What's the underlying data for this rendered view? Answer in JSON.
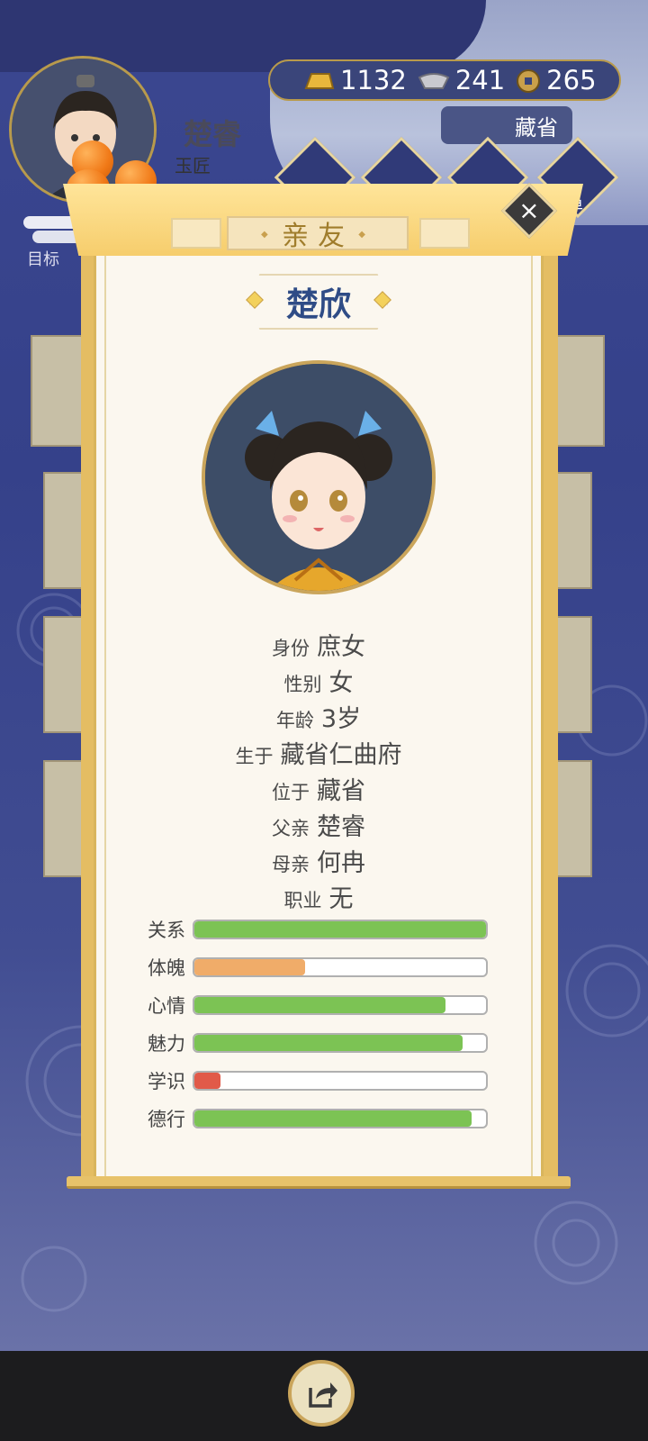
{
  "player": {
    "name": "楚睿",
    "job": "玉匠",
    "goal_label": "目标"
  },
  "currencies": [
    {
      "icon": "gold-ingot-icon",
      "value": "1132"
    },
    {
      "icon": "silver-ingot-icon",
      "value": "241"
    },
    {
      "icon": "copper-coin-icon",
      "value": "265"
    }
  ],
  "region_button": "藏省",
  "menu_partial_label": "单",
  "modal": {
    "title": "亲友",
    "close_icon": "close-icon",
    "person_name": "楚欣",
    "info": [
      {
        "label": "身份",
        "value": "庶女"
      },
      {
        "label": "性别",
        "value": "女"
      },
      {
        "label": "年龄",
        "value": "3岁"
      },
      {
        "label": "生于",
        "value": "藏省仁曲府"
      },
      {
        "label": "位于",
        "value": "藏省"
      },
      {
        "label": "父亲",
        "value": "楚睿"
      },
      {
        "label": "母亲",
        "value": "何冉"
      },
      {
        "label": "职业",
        "value": "无"
      }
    ],
    "stats": [
      {
        "label": "关系",
        "fraction": 1.0,
        "color": "#7cc354"
      },
      {
        "label": "体魄",
        "fraction": 0.38,
        "color": "#f0ac69"
      },
      {
        "label": "心情",
        "fraction": 0.86,
        "color": "#7cc354"
      },
      {
        "label": "魅力",
        "fraction": 0.92,
        "color": "#7cc354"
      },
      {
        "label": "学识",
        "fraction": 0.09,
        "color": "#e15a49"
      },
      {
        "label": "德行",
        "fraction": 0.95,
        "color": "#7cc354"
      }
    ]
  },
  "bottom": {
    "share_icon": "share-icon"
  }
}
